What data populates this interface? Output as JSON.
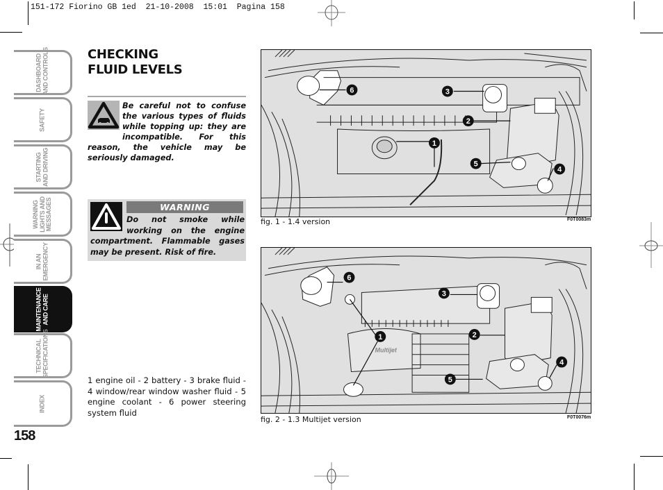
{
  "print_header": "151-172 Fiorino GB 1ed  21-10-2008  15:01  Pagina 158",
  "side_tabs": [
    {
      "label": "DASHBOARD\nAND CONTROLS",
      "active": false
    },
    {
      "label": "SAFETY",
      "active": false
    },
    {
      "label": "STARTING\nAND DRIVING",
      "active": false
    },
    {
      "label": "WARNING\nLIGHTS AND\nMESSAGES",
      "active": false
    },
    {
      "label": "IN AN\nEMERGENCY",
      "active": false
    },
    {
      "label": "MAINTENANCE\nAND CARE",
      "active": true
    },
    {
      "label": "TECHNICAL\nSPECIFICATIONS",
      "active": false
    },
    {
      "label": "INDEX",
      "active": false
    }
  ],
  "page_number": "158",
  "section": {
    "title_line1": "CHECKING",
    "title_line2": "FLUID LEVELS"
  },
  "caution": {
    "icon": "vehicle-caution-triangle-icon",
    "text": "Be careful not to confuse the various types of fluids while topping up: they are incompatible. For this reason, the vehicle may be seriously damaged."
  },
  "warning": {
    "icon": "exclamation-triangle-icon",
    "heading": "WARNING",
    "text": "Do not smoke while working on the engine compartment. Flammable gases may be present. Risk of fire."
  },
  "legend_text": "1 engine oil - 2 battery - 3 brake fluid - 4 window/rear window washer fluid - 5 engine coolant - 6 power steering system fluid",
  "figures": [
    {
      "caption": "fig. 1 - 1.4 version",
      "code": "F0T0083m",
      "callouts": [
        "1",
        "2",
        "3",
        "4",
        "5",
        "6"
      ]
    },
    {
      "caption": "fig. 2 - 1.3 Multijet version",
      "code": "F0T0076m",
      "engine_badge": "Multijet",
      "callouts": [
        "1",
        "2",
        "3",
        "4",
        "5",
        "6"
      ]
    }
  ]
}
